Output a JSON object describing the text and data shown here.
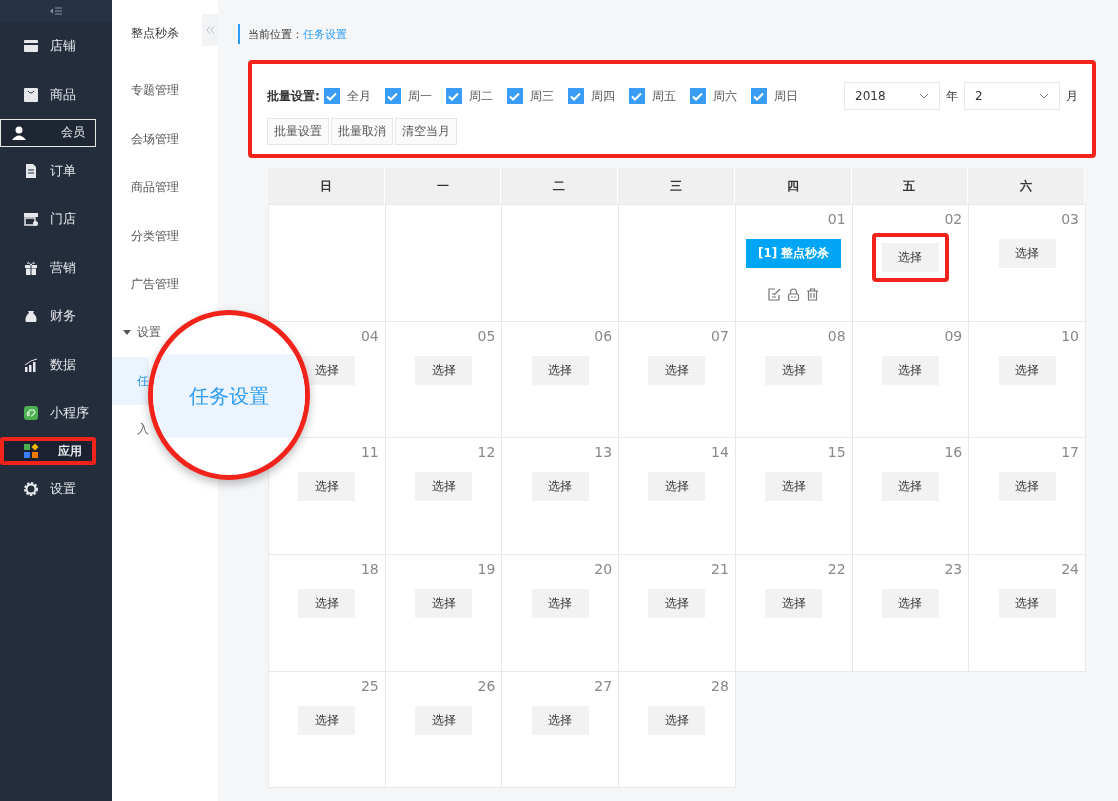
{
  "sidebar": {
    "items": [
      {
        "label": "店铺",
        "selected": false,
        "highlighted": false
      },
      {
        "label": "商品",
        "selected": false,
        "highlighted": false
      },
      {
        "label": "会员",
        "selected": true,
        "highlighted": false
      },
      {
        "label": "订单",
        "selected": false,
        "highlighted": false
      },
      {
        "label": "门店",
        "selected": false,
        "highlighted": false
      },
      {
        "label": "营销",
        "selected": false,
        "highlighted": false
      },
      {
        "label": "财务",
        "selected": false,
        "highlighted": false
      },
      {
        "label": "数据",
        "selected": false,
        "highlighted": false
      },
      {
        "label": "小程序",
        "selected": false,
        "highlighted": false
      },
      {
        "label": "应用",
        "selected": true,
        "highlighted": true
      },
      {
        "label": "设置",
        "selected": false,
        "highlighted": false
      }
    ]
  },
  "subnav": {
    "title": "整点秒杀",
    "items": [
      {
        "label": "专题管理",
        "selected": false
      },
      {
        "label": "会场管理",
        "selected": false
      },
      {
        "label": "商品管理",
        "selected": false
      },
      {
        "label": "分类管理",
        "selected": false
      },
      {
        "label": "广告管理",
        "selected": false
      },
      {
        "label": "设置",
        "expanded": true,
        "children": [
          {
            "label": "任",
            "selected": true
          },
          {
            "label": "入",
            "selected": false
          }
        ]
      }
    ]
  },
  "magnifier": {
    "text": "任务设置"
  },
  "breadcrumb": {
    "label": "当前位置：",
    "current": "任务设置"
  },
  "batch": {
    "highlighted": true,
    "label": "批量设置:",
    "options": [
      {
        "label": "全月",
        "checked": true
      },
      {
        "label": "周一",
        "checked": true
      },
      {
        "label": "周二",
        "checked": true
      },
      {
        "label": "周三",
        "checked": true
      },
      {
        "label": "周四",
        "checked": true
      },
      {
        "label": "周五",
        "checked": true
      },
      {
        "label": "周六",
        "checked": true
      },
      {
        "label": "周日",
        "checked": true
      }
    ],
    "year": {
      "value": "2018",
      "unit": "年"
    },
    "month": {
      "value": "2",
      "unit": "月"
    },
    "buttons": [
      "批量设置",
      "批量取消",
      "清空当月"
    ]
  },
  "calendar": {
    "weekdays": [
      "日",
      "一",
      "二",
      "三",
      "四",
      "五",
      "六"
    ],
    "days": [
      {
        "kind": "blank"
      },
      {
        "kind": "blank"
      },
      {
        "kind": "blank"
      },
      {
        "kind": "blank"
      },
      {
        "kind": "event",
        "date": "01",
        "event": "[1] 整点秒杀"
      },
      {
        "kind": "day",
        "date": "02",
        "button": "选择",
        "highlighted": true
      },
      {
        "kind": "day",
        "date": "03",
        "button": "选择",
        "highlighted": false
      },
      {
        "kind": "day",
        "date": "04",
        "button": "选择",
        "highlighted": false
      },
      {
        "kind": "day",
        "date": "05",
        "button": "选择",
        "highlighted": false
      },
      {
        "kind": "day",
        "date": "06",
        "button": "选择",
        "highlighted": false
      },
      {
        "kind": "day",
        "date": "07",
        "button": "选择",
        "highlighted": false
      },
      {
        "kind": "day",
        "date": "08",
        "button": "选择",
        "highlighted": false
      },
      {
        "kind": "day",
        "date": "09",
        "button": "选择",
        "highlighted": false
      },
      {
        "kind": "day",
        "date": "10",
        "button": "选择",
        "highlighted": false
      },
      {
        "kind": "day",
        "date": "11",
        "button": "选择",
        "highlighted": false
      },
      {
        "kind": "day",
        "date": "12",
        "button": "选择",
        "highlighted": false
      },
      {
        "kind": "day",
        "date": "13",
        "button": "选择",
        "highlighted": false
      },
      {
        "kind": "day",
        "date": "14",
        "button": "选择",
        "highlighted": false
      },
      {
        "kind": "day",
        "date": "15",
        "button": "选择",
        "highlighted": false
      },
      {
        "kind": "day",
        "date": "16",
        "button": "选择",
        "highlighted": false
      },
      {
        "kind": "day",
        "date": "17",
        "button": "选择",
        "highlighted": false
      },
      {
        "kind": "day",
        "date": "18",
        "button": "选择",
        "highlighted": false
      },
      {
        "kind": "day",
        "date": "19",
        "button": "选择",
        "highlighted": false
      },
      {
        "kind": "day",
        "date": "20",
        "button": "选择",
        "highlighted": false
      },
      {
        "kind": "day",
        "date": "21",
        "button": "选择",
        "highlighted": false
      },
      {
        "kind": "day",
        "date": "22",
        "button": "选择",
        "highlighted": false
      },
      {
        "kind": "day",
        "date": "23",
        "button": "选择",
        "highlighted": false
      },
      {
        "kind": "day",
        "date": "24",
        "button": "选择",
        "highlighted": false
      },
      {
        "kind": "day",
        "date": "25",
        "button": "选择",
        "highlighted": false
      },
      {
        "kind": "day",
        "date": "26",
        "button": "选择",
        "highlighted": false
      },
      {
        "kind": "day",
        "date": "27",
        "button": "选择",
        "highlighted": false
      },
      {
        "kind": "day",
        "date": "28",
        "button": "选择",
        "highlighted": false
      }
    ]
  }
}
